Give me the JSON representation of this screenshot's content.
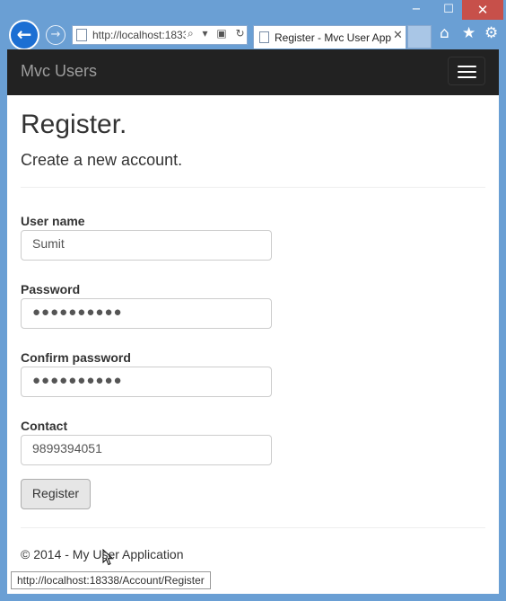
{
  "window": {
    "minimize": "−",
    "maximize": "☐",
    "close": "✕"
  },
  "browser": {
    "back_icon": "arrow-left-icon",
    "address": "http://localhost:1833",
    "address_icons": "⌕ ▾ ▣ ↻",
    "tab_title": "Register - Mvc User App",
    "tab_close": "✕",
    "tools": {
      "home": "⌂",
      "favorites": "★",
      "settings": "⚙"
    },
    "status_url": "http://localhost:18338/Account/Register"
  },
  "site": {
    "brand": "Mvc Users"
  },
  "form": {
    "title": "Register.",
    "subtitle": "Create a new account.",
    "username_label": "User name",
    "username_value": "Sumit",
    "password_label": "Password",
    "password_value": "●●●●●●●●●●",
    "confirm_label": "Confirm password",
    "confirm_value": "●●●●●●●●●●",
    "contact_label": "Contact",
    "contact_value": "9899394051",
    "submit_label": "Register"
  },
  "footer": {
    "text": "© 2014 - My User Application"
  }
}
